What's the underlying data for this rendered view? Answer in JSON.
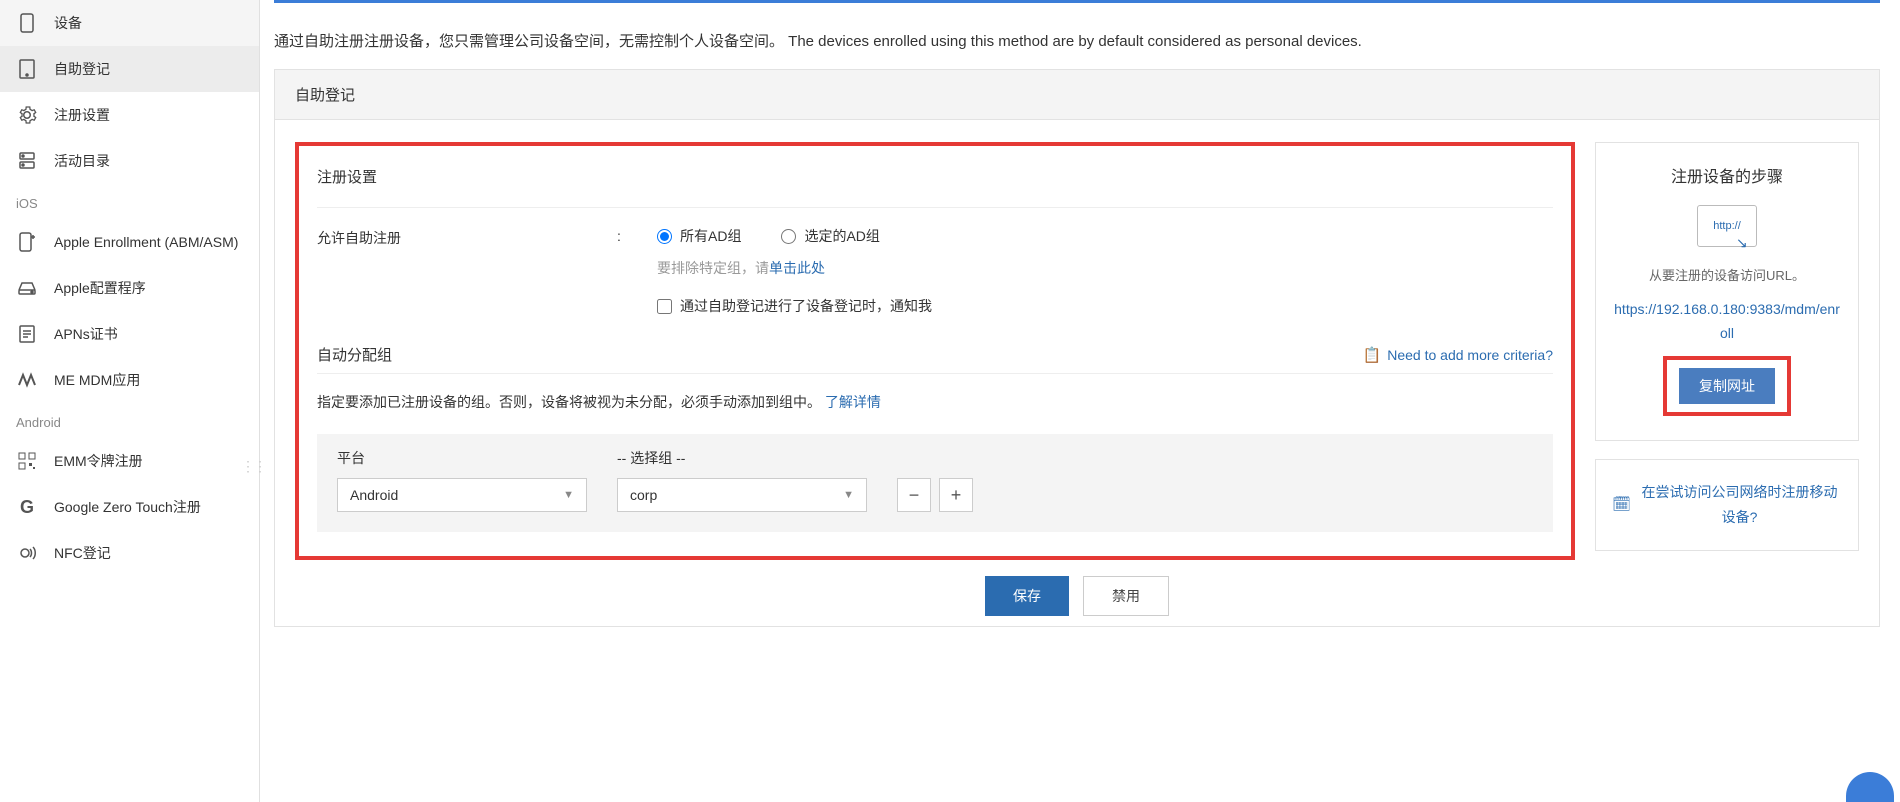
{
  "sidebar": {
    "items": [
      {
        "label": "设备"
      },
      {
        "label": "自助登记"
      },
      {
        "label": "注册设置"
      },
      {
        "label": "活动目录"
      }
    ],
    "sections": {
      "ios": {
        "label": "iOS",
        "items": [
          {
            "label": "Apple Enrollment (ABM/ASM)"
          },
          {
            "label": "Apple配置程序"
          },
          {
            "label": "APNs证书"
          },
          {
            "label": "ME MDM应用"
          }
        ]
      },
      "android": {
        "label": "Android",
        "items": [
          {
            "label": "EMM令牌注册"
          },
          {
            "label": "Google Zero Touch注册"
          },
          {
            "label": "NFC登记"
          }
        ]
      }
    }
  },
  "intro": "通过自助注册注册设备，您只需管理公司设备空间，无需控制个人设备空间。 The devices enrolled using this method are by default considered as personal devices.",
  "panel_title": "自助登记",
  "settings": {
    "title": "注册设置",
    "allow_label": "允许自助注册",
    "all_ad": "所有AD组",
    "selected_ad": "选定的AD组",
    "exclude_hint": "要排除特定组，请",
    "click_here": "单击此处",
    "notify_label": "通过自助登记进行了设备登记时，通知我"
  },
  "auto_assign": {
    "title": "自动分配组",
    "need_criteria": "Need to add more criteria?",
    "desc": "指定要添加已注册设备的组。否则，设备将被视为未分配，必须手动添加到组中。",
    "learn_more": "了解详情",
    "platform_header": "平台",
    "group_header": "-- 选择组 --",
    "platform_value": "Android",
    "group_value": "corp"
  },
  "steps": {
    "title": "注册设备的步骤",
    "http_badge": "http://",
    "desc": "从要注册的设备访问URL。",
    "url": "https://192.168.0.180:9383/mdm/enroll",
    "copy_btn": "复制网址",
    "secondary_link": "在尝试访问公司网络时注册移动设备?"
  },
  "actions": {
    "save": "保存",
    "disable": "禁用"
  }
}
